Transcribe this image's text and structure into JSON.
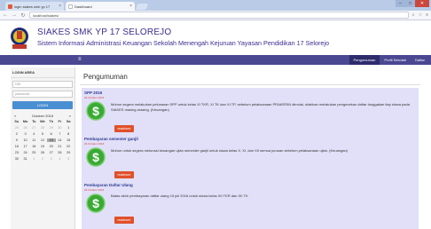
{
  "browser": {
    "tabs": [
      {
        "label": "login siakes smk yp 17"
      },
      {
        "label": "Dashboard"
      }
    ],
    "address": "localhost/siakes/",
    "window": {
      "minimize": "–",
      "maximize": "□",
      "close": "✕"
    }
  },
  "header": {
    "title": "SIAKES SMK YP 17 SELOREJO",
    "subtitle": "Sistem Informasi Administrasi Keuangan Sekolah Menengah Kejuruan Yayasan Pendidikan 17 Selorejo"
  },
  "navbar": {
    "menu_icon": "≡",
    "links": [
      {
        "label": "Pengumuman"
      },
      {
        "label": "Profil Sekolah"
      },
      {
        "label": "Daftar"
      }
    ]
  },
  "sidebar": {
    "heading": "LOGIN AREA",
    "nis_placeholder": "NIS",
    "password_placeholder": "password",
    "login_label": "LOGIN",
    "calendar": {
      "prev": "«",
      "next": "»",
      "month": "October 2016",
      "days": [
        "Su",
        "Mo",
        "Tu",
        "We",
        "Th",
        "Fr",
        "Sa"
      ],
      "weeks": [
        [
          "25",
          "26",
          "27",
          "28",
          "29",
          "30",
          "1"
        ],
        [
          "2",
          "3",
          "4",
          "5",
          "6",
          "7",
          "8"
        ],
        [
          "9",
          "10",
          "11",
          "12",
          "13",
          "14",
          "15"
        ],
        [
          "16",
          "17",
          "18",
          "19",
          "20",
          "21",
          "22"
        ],
        [
          "23",
          "24",
          "25",
          "26",
          "27",
          "28",
          "29"
        ],
        [
          "30",
          "31",
          "1",
          "2",
          "3",
          "4",
          "5"
        ]
      ],
      "today": "13"
    }
  },
  "main": {
    "title": "Pengumuman",
    "announcements": [
      {
        "title": "SPP 2016",
        "date": "29 October 2016",
        "body": "Mohon segera melakukan pelunasan SPP untuk kelas XI TKR, XI TK dan XI TP, sebelum pelaksanaan PRAKERIN dimulai, silahkan melakukan pengecekan daftar tunggakan tiap siswa pada SIAKES masing-masing. (Keuangan)",
        "button": "readmore"
      },
      {
        "title": "Pembayaran semester ganjil",
        "date": "29 October 2016",
        "body": "Mohon untuk segera melunasi keuangan ujian semester ganjil untuk siswa kelas X, XI, dan XII semua jurusan sebelum pelaksanaan ujian. (Keuangan)",
        "button": "readmore"
      },
      {
        "title": "Pembayaran Daftar Ulang",
        "date": "29 October 2016",
        "body": "Batas akhir pembayaran daftar ulang 19 juli 2016 untuk siswa kelas XII TKR dan XII TK",
        "button": "readmore"
      }
    ]
  }
}
